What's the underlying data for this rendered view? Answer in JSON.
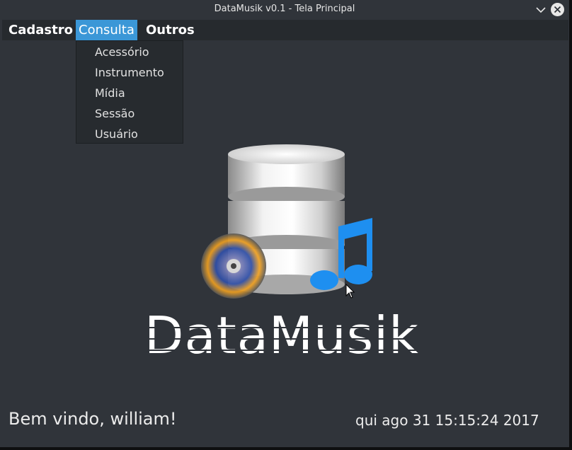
{
  "window": {
    "title": "DataMusik v0.1 - Tela Principal"
  },
  "menubar": {
    "items": [
      {
        "label": "Cadastro"
      },
      {
        "label": "Consulta",
        "active": true
      },
      {
        "label": "Outros"
      }
    ]
  },
  "dropdown": {
    "items": [
      {
        "label": "Acessório"
      },
      {
        "label": "Instrumento"
      },
      {
        "label": "Mídia"
      },
      {
        "label": "Sessão"
      },
      {
        "label": "Usuário"
      }
    ]
  },
  "logo": {
    "text": "DataMusik"
  },
  "status": {
    "welcome": "Bem vindo, william!",
    "datetime": "qui ago 31 15:15:24 2017"
  },
  "icons": {
    "minimize": "chevron-down-icon",
    "close": "close-icon",
    "database": "database-icon",
    "music_note": "music-note-icon",
    "media_disc": "media-disc-icon",
    "cursor": "mouse-cursor-icon"
  },
  "colors": {
    "window_bg": "#30343a",
    "menubar_bg": "#262a2e",
    "active_menu": "#3b97d7",
    "music_note": "#1e8ff0"
  }
}
